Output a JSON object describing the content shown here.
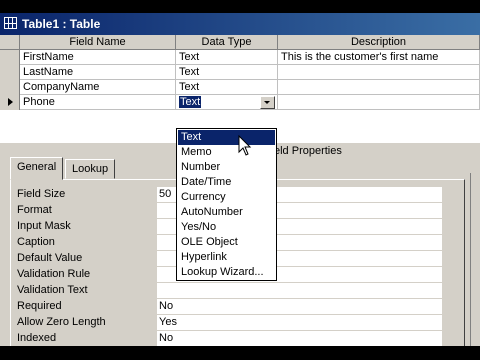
{
  "window": {
    "title": "Table1 : Table"
  },
  "columns": {
    "field_name": "Field Name",
    "data_type": "Data Type",
    "description": "Description"
  },
  "rows": [
    {
      "field": "FirstName",
      "type": "Text",
      "description": "This is the customer's first name"
    },
    {
      "field": "LastName",
      "type": "Text",
      "description": ""
    },
    {
      "field": "CompanyName",
      "type": "Text",
      "description": ""
    },
    {
      "field": "Phone",
      "type": "Text",
      "description": ""
    }
  ],
  "dropdown": {
    "options": [
      "Text",
      "Memo",
      "Number",
      "Date/Time",
      "Currency",
      "AutoNumber",
      "Yes/No",
      "OLE Object",
      "Hyperlink",
      "Lookup Wizard..."
    ],
    "highlighted": "Text"
  },
  "field_properties_label": "eld Properties",
  "tabs": [
    {
      "label": "General"
    },
    {
      "label": "Lookup"
    }
  ],
  "properties": [
    {
      "label": "Field Size",
      "value": "50"
    },
    {
      "label": "Format",
      "value": ""
    },
    {
      "label": "Input Mask",
      "value": ""
    },
    {
      "label": "Caption",
      "value": ""
    },
    {
      "label": "Default Value",
      "value": ""
    },
    {
      "label": "Validation Rule",
      "value": ""
    },
    {
      "label": "Validation Text",
      "value": ""
    },
    {
      "label": "Required",
      "value": "No"
    },
    {
      "label": "Allow Zero Length",
      "value": "Yes"
    },
    {
      "label": "Indexed",
      "value": "No"
    }
  ],
  "colors": {
    "titlebar": "#0a246a",
    "selection": "#0a246a",
    "face": "#d4d0c8"
  }
}
